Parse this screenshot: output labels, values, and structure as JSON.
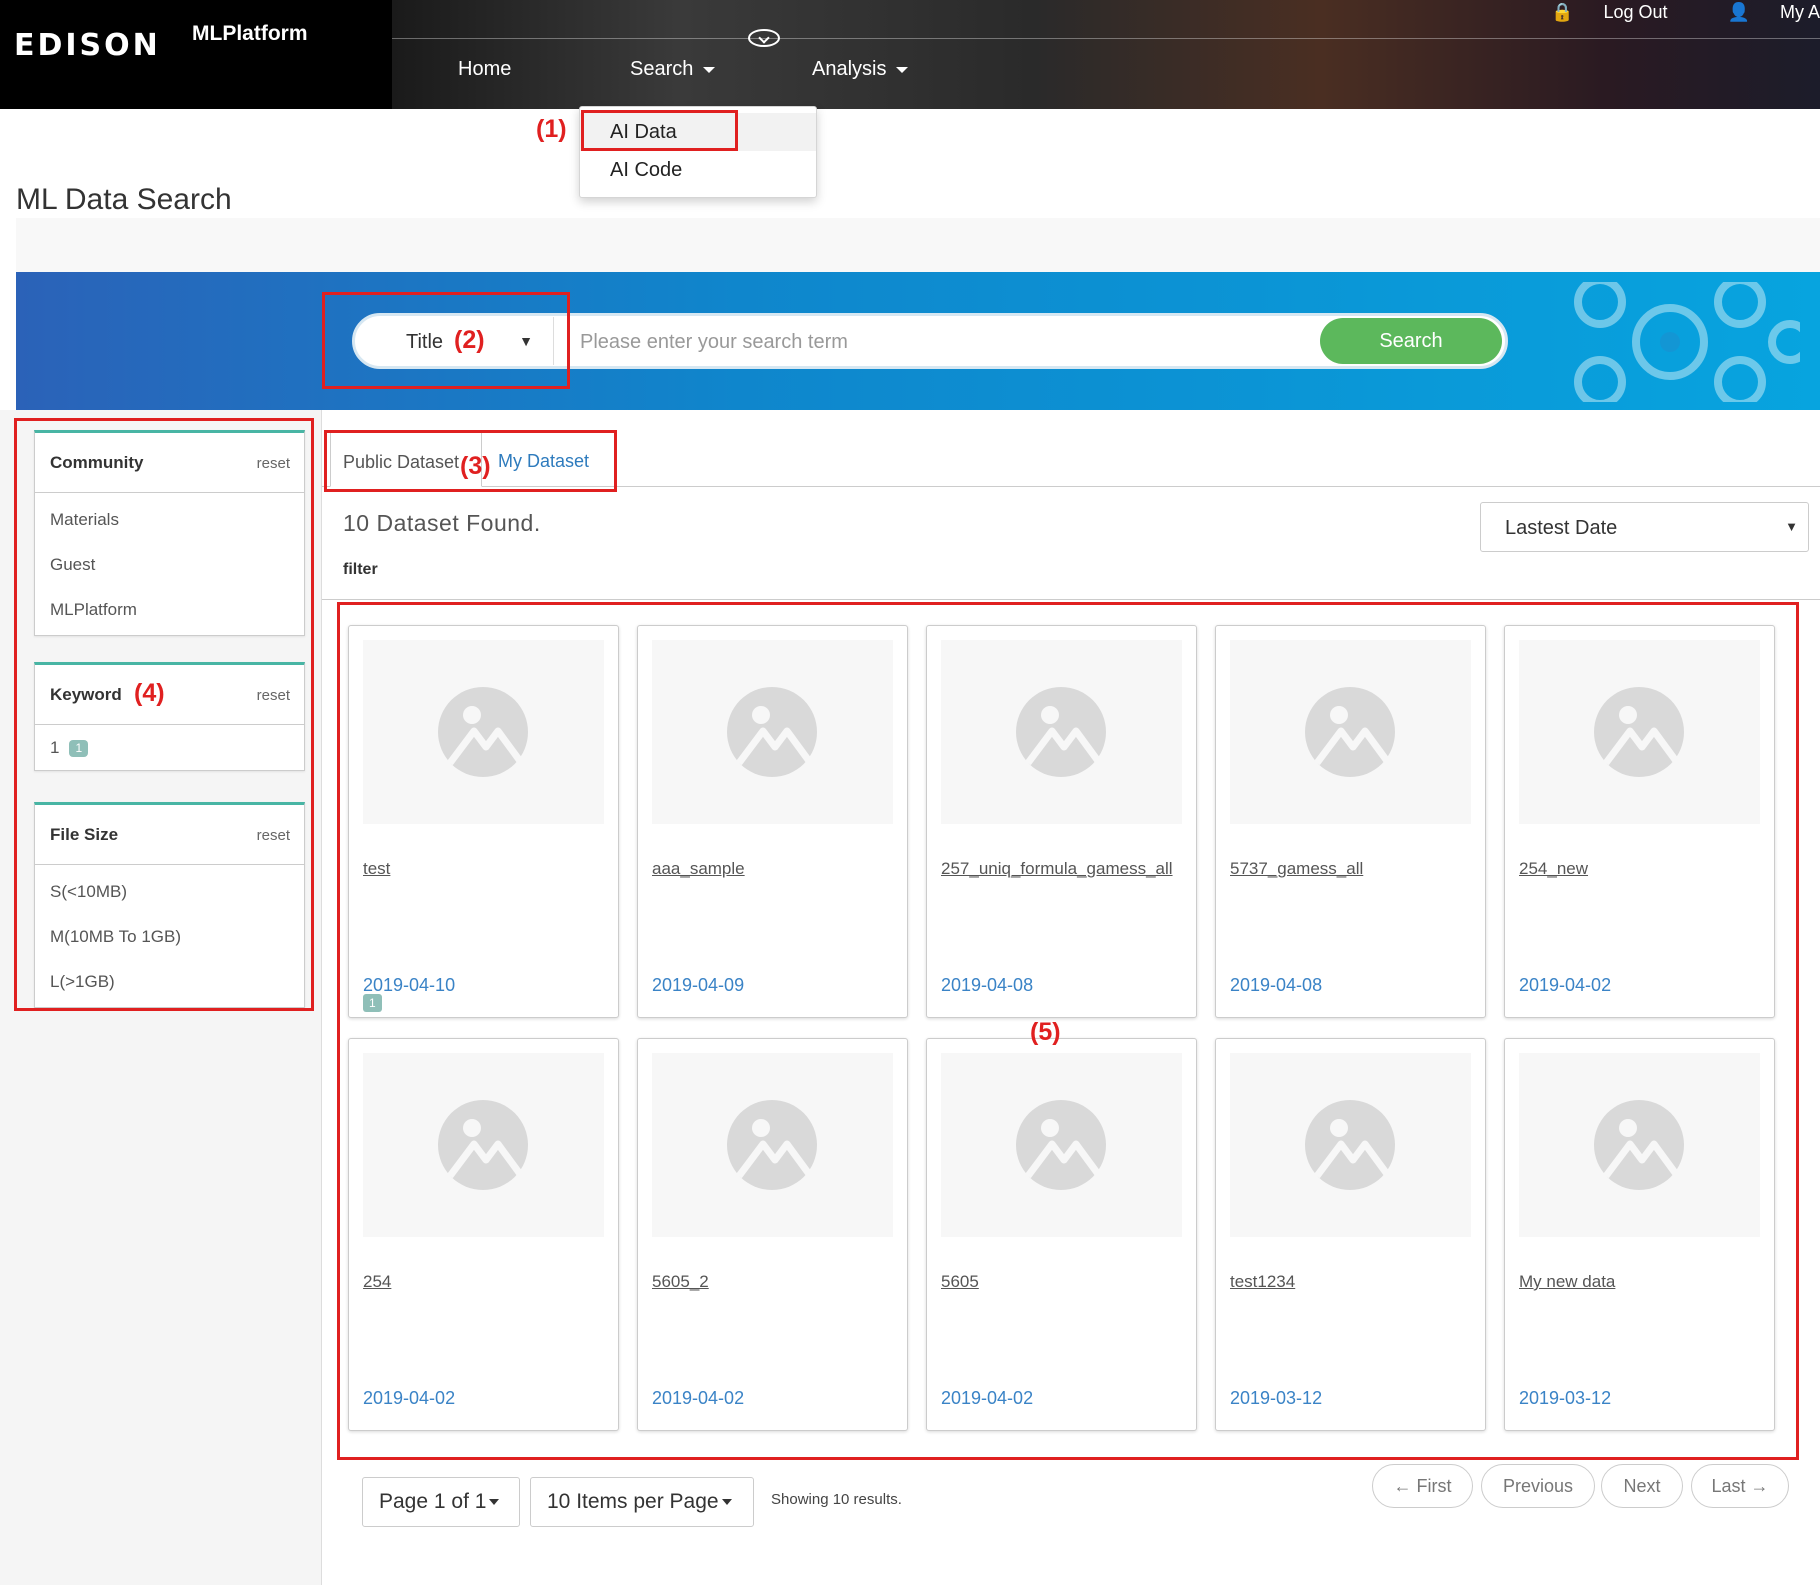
{
  "header": {
    "logo": "EDISON",
    "platform": "MLPlatform",
    "nav": [
      {
        "label": "Home"
      },
      {
        "label": "Search"
      },
      {
        "label": "Analysis"
      }
    ],
    "logout": "Log Out",
    "my_account": "My A"
  },
  "dropdown": {
    "items": [
      {
        "label": "AI Data"
      },
      {
        "label": "AI Code"
      }
    ]
  },
  "page": {
    "title": "ML Data Search"
  },
  "search": {
    "field_select": "Title",
    "placeholder": "Please enter your search term",
    "button": "Search"
  },
  "filters": {
    "community": {
      "title": "Community",
      "reset": "reset",
      "items": [
        "Materials",
        "Guest",
        "MLPlatform"
      ]
    },
    "keyword": {
      "title": "Keyword",
      "reset": "reset",
      "item": "1",
      "count": "1"
    },
    "filesize": {
      "title": "File Size",
      "reset": "reset",
      "items": [
        "S(<10MB)",
        "M(10MB To 1GB)",
        "L(>1GB)"
      ]
    }
  },
  "tabs": {
    "public": "Public Dataset",
    "my": "My Dataset"
  },
  "results": {
    "found": "10 Dataset Found.",
    "filter_label": "filter",
    "sort": "Lastest Date"
  },
  "datasets": [
    {
      "name": "test",
      "date": "2019-04-10",
      "badge": "1"
    },
    {
      "name": "aaa_sample",
      "date": "2019-04-09"
    },
    {
      "name": "257_uniq_formula_gamess_all",
      "date": "2019-04-08"
    },
    {
      "name": "5737_gamess_all",
      "date": "2019-04-08"
    },
    {
      "name": "254_new",
      "date": "2019-04-02"
    },
    {
      "name": "254",
      "date": "2019-04-02"
    },
    {
      "name": "5605_2",
      "date": "2019-04-02"
    },
    {
      "name": "5605",
      "date": "2019-04-02"
    },
    {
      "name": "test1234",
      "date": "2019-03-12"
    },
    {
      "name": "My new data",
      "date": "2019-03-12"
    }
  ],
  "pagination": {
    "page_select": "Page 1 of 1",
    "per_page": "10 Items per Page",
    "showing": "Showing 10 results.",
    "first": "← First",
    "previous": "Previous",
    "next": "Next",
    "last": "Last →"
  },
  "annotations": [
    "(1)",
    "(2)",
    "(3)",
    "(4)",
    "(5)"
  ],
  "colors": {
    "accent_green": "#5cb85c",
    "link_blue": "#3a83c6",
    "annotation_red": "#e02020",
    "filter_border_teal": "#48b5a4"
  }
}
